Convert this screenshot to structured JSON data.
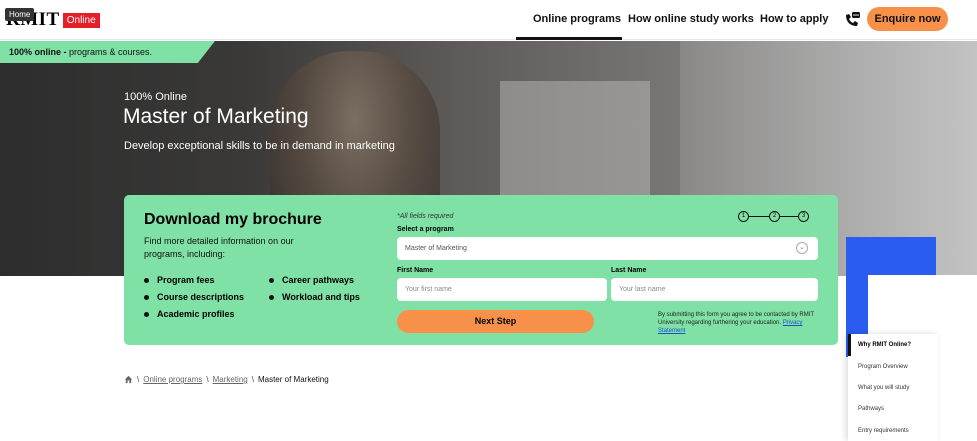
{
  "header": {
    "logo_text": "RMIT",
    "logo_badge": "Online",
    "home_tooltip": "Home",
    "nav": [
      "Online programs",
      "How online study works",
      "How to apply"
    ],
    "enquire_label": "Enquire now"
  },
  "hero": {
    "banner_bold": "100% online -",
    "banner_rest": " programs & courses.",
    "label": "100% Online",
    "title": "Master of Marketing",
    "subtitle": "Develop exceptional skills to be in demand in marketing"
  },
  "form": {
    "title": "Download my brochure",
    "intro": "Find more detailed information on our programs, including:",
    "bullets_left": [
      "Program fees",
      "Course descriptions",
      "Academic profiles"
    ],
    "bullets_right": [
      "Career pathways",
      "Workload and tips"
    ],
    "required_note": "*All fields required",
    "steps": [
      "1",
      "2",
      "3"
    ],
    "program_label": "Select a program",
    "program_value": "Master of Marketing",
    "first_name_label": "First Name",
    "first_name_placeholder": "Your first name",
    "last_name_label": "Last Name",
    "last_name_placeholder": "Your last name",
    "next_label": "Next Step",
    "consent_text": "By submitting this form you agree to be contacted by RMIT University regarding furthering your education.",
    "privacy_link": "Privacy Statement"
  },
  "breadcrumb": {
    "links": [
      "Online programs",
      "Marketing"
    ],
    "current": "Master of Marketing"
  },
  "side_nav": {
    "items": [
      "Why RMIT Online?",
      "Program Overview",
      "What you will study",
      "Pathways",
      "Entry requirements"
    ]
  },
  "colors": {
    "accent_green": "#7fe1a5",
    "accent_orange": "#f7914a",
    "brand_red": "#e61e2a",
    "blue_block": "#2b5cf0"
  }
}
